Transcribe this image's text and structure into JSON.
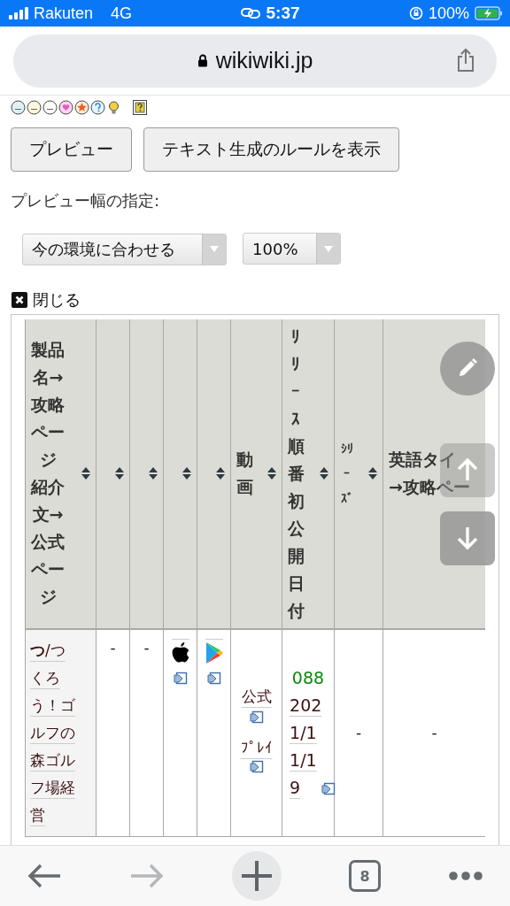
{
  "status_bar": {
    "carrier": "Rakuten",
    "network": "4G",
    "time": "5:37",
    "battery": "100%"
  },
  "address_bar": {
    "url": "wikiwiki.jp"
  },
  "buttons": [
    {
      "label": "プレビュー"
    },
    {
      "label": "テキスト生成のルールを表示"
    }
  ],
  "preview_width": {
    "label": "プレビュー幅の指定:",
    "mode": "今の環境に合わせる",
    "zoom": "100%"
  },
  "close_link": {
    "label": "閉じる"
  },
  "table": {
    "columns": [
      {
        "lines": [
          "製品名→攻略ページ",
          "紹介文→公式ページ"
        ],
        "sortable": true
      },
      {
        "sortable": true
      },
      {
        "sortable": true
      },
      {
        "sortable": true
      },
      {
        "sortable": true
      },
      {
        "lines": [
          "動画"
        ],
        "sortable": true
      },
      {
        "lines": [
          "ﾘﾘｰｽ順番初公開日付"
        ],
        "sortable": true
      },
      {
        "lines": [
          "ｼﾘｰｽﾞ"
        ],
        "sortable": true
      },
      {
        "lines": [
          "英語タイ",
          "→攻略ペー"
        ],
        "sortable": false
      }
    ],
    "rows": [
      {
        "cells": [
          {
            "kind": "title_link",
            "text": "**つ**/つくろう！ゴルフの森ゴルフ場経営"
          },
          {
            "kind": "text",
            "text": "-"
          },
          {
            "kind": "text",
            "text": "-"
          },
          {
            "kind": "app_store"
          },
          {
            "kind": "play_store"
          },
          {
            "kind": "links",
            "links": [
              "公式",
              "ﾌﾟﾚｲ"
            ]
          },
          {
            "kind": "release",
            "number": "088",
            "date": "2021/11/19"
          },
          {
            "kind": "text",
            "text": "-"
          },
          {
            "kind": "text",
            "text": "-"
          }
        ]
      }
    ]
  },
  "toolbar": {
    "forward_disabled": true,
    "tab_count": "8"
  }
}
